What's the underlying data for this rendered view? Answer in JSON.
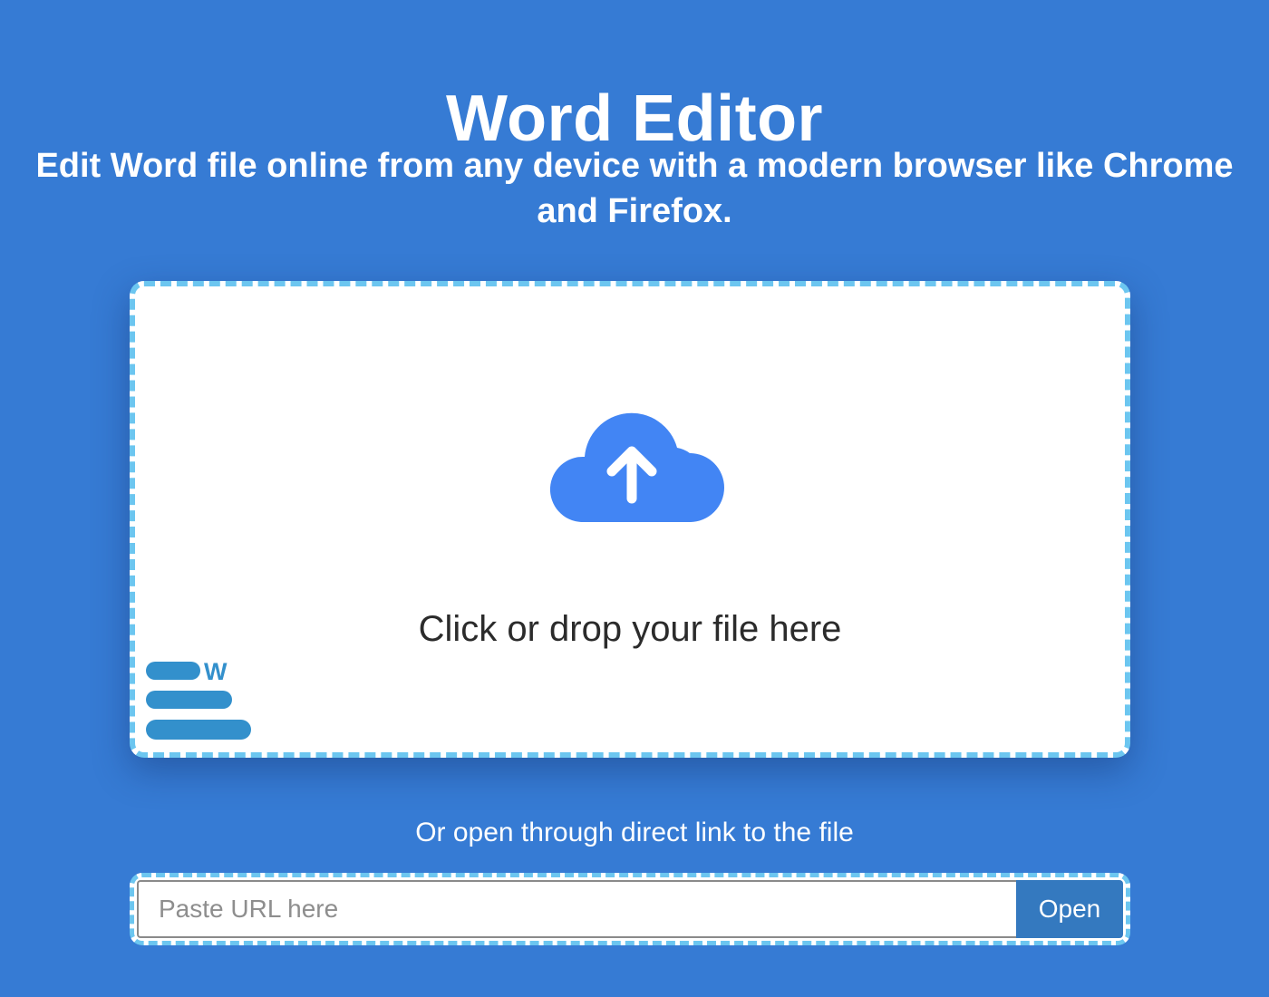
{
  "header": {
    "title": "Word Editor",
    "subtitle": "Edit Word file online from any device with a modern browser like Chrome and Firefox."
  },
  "dropzone": {
    "text": "Click or drop your file here",
    "icon": "cloud-upload-icon",
    "logo_icon": "word-document-icon",
    "logo_letter": "W"
  },
  "url_section": {
    "label": "Or open through direct link to the file",
    "placeholder": "Paste URL here",
    "value": "",
    "button_label": "Open"
  },
  "colors": {
    "background": "#367bd4",
    "dropzone_border": "#6cc6f0",
    "icon_blue": "#4285f4",
    "logo_blue": "#3390cc",
    "button_blue": "#3479bf"
  }
}
